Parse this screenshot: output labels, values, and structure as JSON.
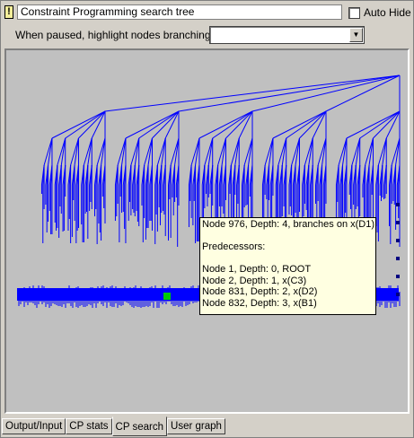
{
  "window": {
    "title_field": "Constraint Programming search tree",
    "auto_hide_label": "Auto Hide",
    "auto_hide_checked": false,
    "warning_glyph": "!"
  },
  "toolbar": {
    "highlight_label": "When paused, highlight nodes branching on",
    "highlight_value": ""
  },
  "tooltip": {
    "header": "Node 976, Depth: 4, branches on x(D1)",
    "predecessors_label": "Predecessors:",
    "predecessors": [
      "Node 1, Depth: 0, ROOT",
      "Node 2, Depth: 1, x(C3)",
      "Node 831, Depth: 2, x(D2)",
      "Node 832, Depth: 3, x(B1)"
    ]
  },
  "tabs": [
    {
      "label": "Output/Input",
      "active": false
    },
    {
      "label": "CP stats",
      "active": false
    },
    {
      "label": "CP search",
      "active": true
    },
    {
      "label": "User graph",
      "active": false
    }
  ],
  "colors": {
    "tree_edge": "#0000ff",
    "canvas_bg": "#c0c0c0",
    "highlight_node": "#00cc00",
    "tooltip_bg": "#ffffe1"
  }
}
